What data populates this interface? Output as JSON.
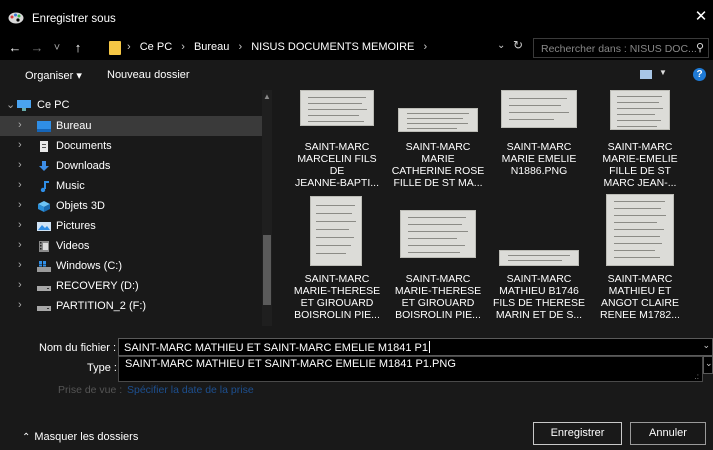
{
  "window": {
    "title": "Enregistrer sous",
    "close_glyph": "✕"
  },
  "nav": {
    "back_glyph": "←",
    "forward_glyph": "→",
    "recent_glyph": "˅",
    "up_glyph": "↑",
    "breadcrumb": [
      "Ce PC",
      "Bureau",
      "NISUS DOCUMENTS MEMOIRE"
    ],
    "crumb_sep": "›",
    "search_placeholder": "Rechercher dans : NISUS DOC..."
  },
  "toolbar": {
    "organize_label": "Organiser ▾",
    "new_folder_label": "Nouveau dossier",
    "help_glyph": "?"
  },
  "sidebar": {
    "root": {
      "label": "Ce PC",
      "icon": "monitor-icon"
    },
    "items": [
      {
        "label": "Bureau",
        "icon": "desktop-icon",
        "selected": true
      },
      {
        "label": "Documents",
        "icon": "documents-icon"
      },
      {
        "label": "Downloads",
        "icon": "downloads-icon"
      },
      {
        "label": "Music",
        "icon": "music-icon"
      },
      {
        "label": "Objets 3D",
        "icon": "cube-icon"
      },
      {
        "label": "Pictures",
        "icon": "pictures-icon"
      },
      {
        "label": "Videos",
        "icon": "videos-icon"
      },
      {
        "label": "Windows (C:)",
        "icon": "windows-drive-icon"
      },
      {
        "label": "RECOVERY (D:)",
        "icon": "drive-icon"
      },
      {
        "label": "PARTITION_2 (F:)",
        "icon": "drive-icon"
      }
    ]
  },
  "files": [
    {
      "lines": [
        "SAINT-MARC",
        "MARCELIN FILS",
        "DE",
        "JEANNE-BAPTI..."
      ]
    },
    {
      "lines": [
        "SAINT-MARC",
        "MARIE",
        "CATHERINE ROSE",
        "FILLE DE ST MA..."
      ]
    },
    {
      "lines": [
        "SAINT-MARC",
        "MARIE EMELIE",
        "N1886.PNG"
      ]
    },
    {
      "lines": [
        "SAINT-MARC",
        "MARIE-EMELIE",
        "FILLE DE ST",
        "MARC JEAN-..."
      ]
    },
    {
      "lines": [
        "SAINT-MARC",
        "MARIE-THERESE",
        "ET GIROUARD",
        "BOISROLIN PIE..."
      ]
    },
    {
      "lines": [
        "SAINT-MARC",
        "MARIE-THERESE",
        "ET GIROUARD",
        "BOISROLIN PIE..."
      ]
    },
    {
      "lines": [
        "SAINT-MARC",
        "MATHIEU B1746",
        "FILS DE THERESE",
        "MARIN ET DE S..."
      ]
    },
    {
      "lines": [
        "SAINT-MARC",
        "MATHIEU ET",
        "ANGOT CLAIRE",
        "RENEE M1782..."
      ]
    }
  ],
  "form": {
    "name_label": "Nom du fichier :",
    "name_value": "SAINT-MARC MATHIEU ET SAINT-MARC EMELIE M1841 P1",
    "type_label": "Type :",
    "suggestion": "SAINT-MARC MATHIEU ET SAINT-MARC EMELIE M1841 P1.PNG",
    "date_label": "Prise de vue :",
    "date_link": "Spécifier la date de la prise"
  },
  "footer": {
    "hide_folders_label": "Masquer les dossiers",
    "save_label": "Enregistrer",
    "cancel_label": "Annuler"
  },
  "colors": {
    "accent": "#1e7ad6",
    "folder": "#f6c745",
    "background": "#191919"
  }
}
